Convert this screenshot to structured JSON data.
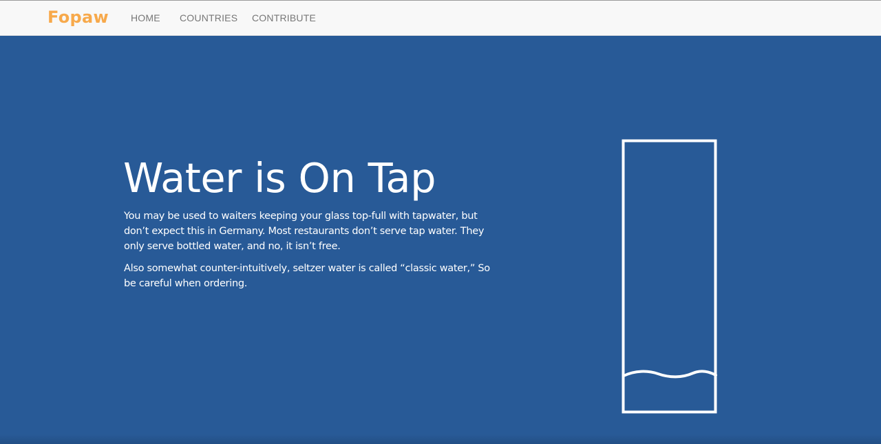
{
  "nav": {
    "brand": "Fopaw",
    "links": [
      "HOME",
      "COUNTRIES",
      "CONTRIBUTE"
    ]
  },
  "hero": {
    "title": "Water is On Tap",
    "paragraphs": [
      "You may be used to waiters keeping your glass top-full with tapwater, but don’t expect this in Germany. Most restaurants don’t serve tap water. They only serve bottled water, and no, it isn’t free.",
      "Also somewhat counter-intuitively, seltzer water is called “classic water,” So be careful when ordering."
    ],
    "illustration": "water-glass-icon"
  },
  "colors": {
    "brand": "#f7a94b",
    "hero_background": "#285a97",
    "navbar_background": "#f8f8f8",
    "nav_text": "#777777",
    "hero_text": "#ffffff"
  }
}
